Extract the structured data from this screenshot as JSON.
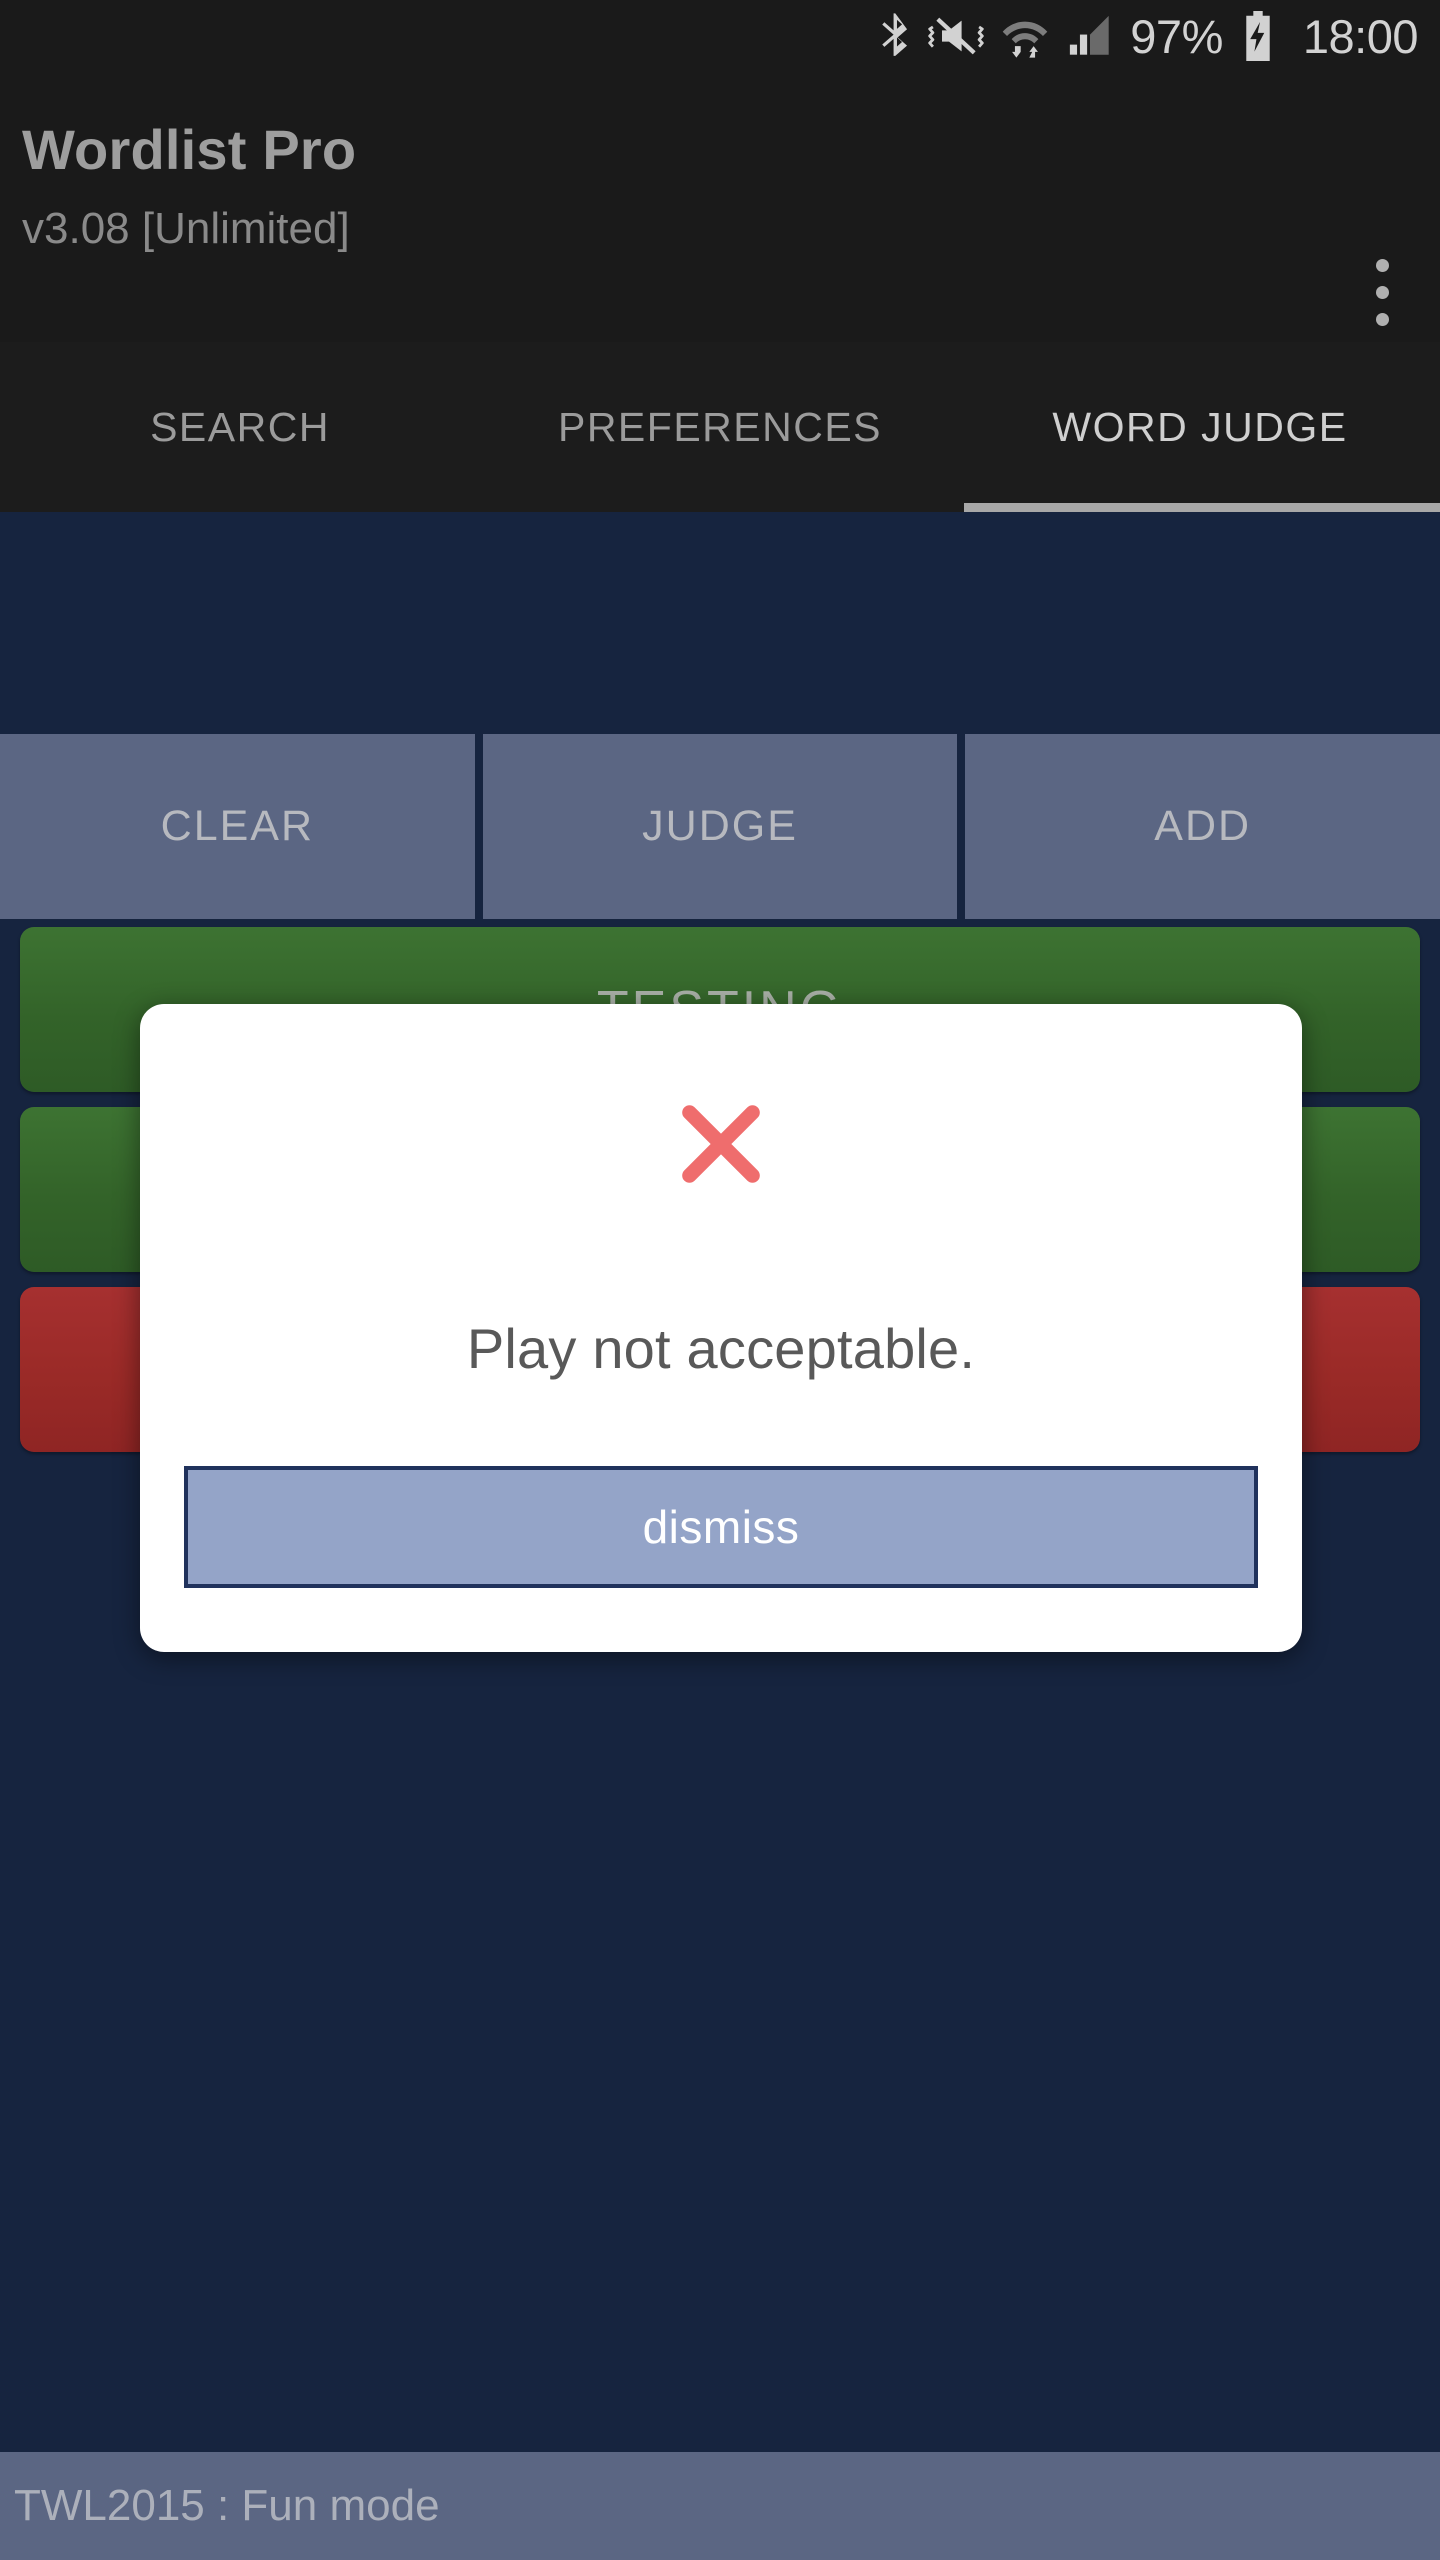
{
  "status_bar": {
    "icons": [
      "bluetooth-icon",
      "vibrate-mute-icon",
      "wifi-icon",
      "signal-icon"
    ],
    "battery_percent": "97%",
    "battery_icon": "battery-charging-icon",
    "clock": "18:00"
  },
  "app_bar": {
    "title": "Wordlist Pro",
    "subtitle": "v3.08 [Unlimited]",
    "overflow_icon": "overflow-menu-icon"
  },
  "tabs": [
    {
      "label": "SEARCH",
      "active": false
    },
    {
      "label": "PREFERENCES",
      "active": false
    },
    {
      "label": "WORD JUDGE",
      "active": true
    }
  ],
  "actions": [
    {
      "label": "CLEAR"
    },
    {
      "label": "JUDGE"
    },
    {
      "label": "ADD"
    }
  ],
  "word_rows": [
    {
      "word": "TESTING",
      "state": "green"
    },
    {
      "word": "",
      "state": "green"
    },
    {
      "word": "",
      "state": "red"
    }
  ],
  "dialog": {
    "icon": "x-cross-icon",
    "icon_color": "#ef6d6d",
    "message": "Play not acceptable.",
    "button_label": "dismiss"
  },
  "bottom_bar": {
    "text": "TWL2015 : Fun mode"
  },
  "colors": {
    "background": "#16243f",
    "appbar": "#1a1a1a",
    "action_button": "#5b6683",
    "row_green": "#336329",
    "row_red": "#9a2a27",
    "dialog_button": "#94a4c8",
    "dialog_button_border": "#20325c",
    "error_x": "#ef6d6d"
  }
}
